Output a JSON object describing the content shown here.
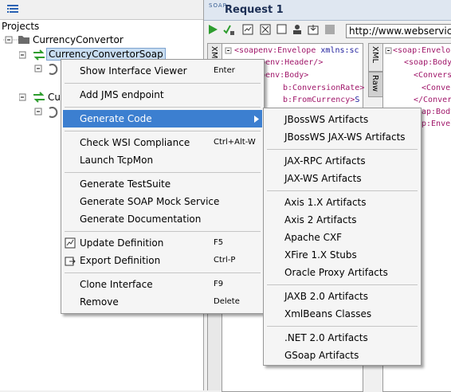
{
  "navigator": {
    "projects_label": "Projects",
    "project_name": "CurrencyConvertor",
    "interface_selected": "CurrencyConvertorSoap",
    "interface_second_partial": "Cu"
  },
  "editor": {
    "soap_badge": "SOAP",
    "title": "Request 1",
    "url": "http://www.webservicex",
    "left_tab": "XML",
    "right_tabs": [
      "Raw",
      "XML"
    ],
    "request_xml": [
      {
        "prefix": "",
        "tag": "<soapenv:Envelope",
        "rest": " xmlns:sc"
      },
      {
        "prefix": "",
        "tag": "<soapenv:Header/>",
        "rest": ""
      },
      {
        "prefix": "",
        "tag": "<soapenv:Body>",
        "rest": ""
      },
      {
        "prefix": "",
        "tag": "b:ConversionRate>",
        "rest": ""
      },
      {
        "prefix": "",
        "tag": "b:FromCurrency>",
        "rest": "S"
      }
    ],
    "response_xml": [
      {
        "tag": "<soap:Envelo"
      },
      {
        "tag": "<soap:Body"
      },
      {
        "tag": "<Convers"
      },
      {
        "tag": "<Conver"
      },
      {
        "tag": "</Convers"
      },
      {
        "tag": "ap:Body>"
      },
      {
        "tag": "p:Envelop"
      }
    ]
  },
  "context_menu": {
    "items": [
      {
        "label": "Show Interface Viewer",
        "accel": "Enter"
      },
      {
        "label": "Add JMS endpoint",
        "accel": ""
      },
      {
        "label": "Generate Code",
        "accel": ""
      },
      {
        "label": "Check WSI Compliance",
        "accel": "Ctrl+Alt-W"
      },
      {
        "label": "Launch TcpMon",
        "accel": ""
      },
      {
        "label": "Generate TestSuite",
        "accel": ""
      },
      {
        "label": "Generate SOAP Mock Service",
        "accel": ""
      },
      {
        "label": "Generate Documentation",
        "accel": ""
      },
      {
        "label": "Update Definition",
        "accel": "F5"
      },
      {
        "label": "Export Definition",
        "accel": "Ctrl-P"
      },
      {
        "label": "Clone Interface",
        "accel": "F9"
      },
      {
        "label": "Remove",
        "accel": "Delete"
      }
    ]
  },
  "submenu": {
    "items": [
      "JBossWS Artifacts",
      "JBossWS JAX-WS Artifacts",
      "JAX-RPC Artifacts",
      "JAX-WS Artifacts",
      "Axis 1.X Artifacts",
      "Axis 2 Artifacts",
      "Apache CXF",
      "XFire 1.X Stubs",
      "Oracle Proxy Artifacts",
      "JAXB 2.0 Artifacts",
      "XmlBeans Classes",
      ".NET 2.0 Artifacts",
      "GSoap Artifacts"
    ]
  },
  "icons": {
    "interface": "interface-arrows-icon",
    "project": "folder-icon",
    "run": "play-icon",
    "highlight_color": "#3c7fd0",
    "interface_color": "#2e9d2e"
  }
}
